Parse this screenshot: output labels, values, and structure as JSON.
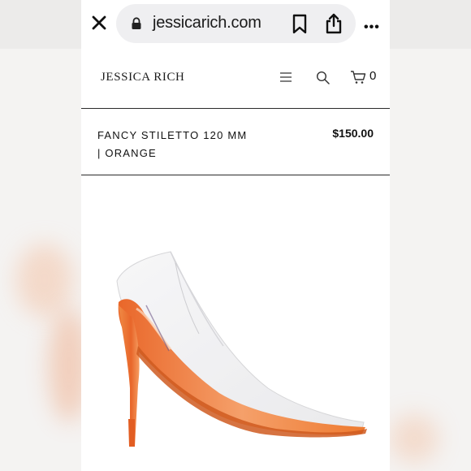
{
  "browser": {
    "url": "jessicarich.com",
    "more_label": "•••",
    "icons": [
      "close-icon",
      "lock-icon",
      "bookmark-icon",
      "share-icon",
      "more-icon"
    ]
  },
  "site": {
    "logo": "JESSICA RICH",
    "cart_count": "0",
    "icons": [
      "hamburger-menu-icon",
      "search-icon",
      "cart-icon"
    ]
  },
  "product": {
    "title_line1": "FANCY STILETTO 120 MM",
    "title_line2": "| ORANGE",
    "price": "$150.00",
    "colors": {
      "accent": "#f0782e",
      "heel": "#ee7a30"
    }
  }
}
